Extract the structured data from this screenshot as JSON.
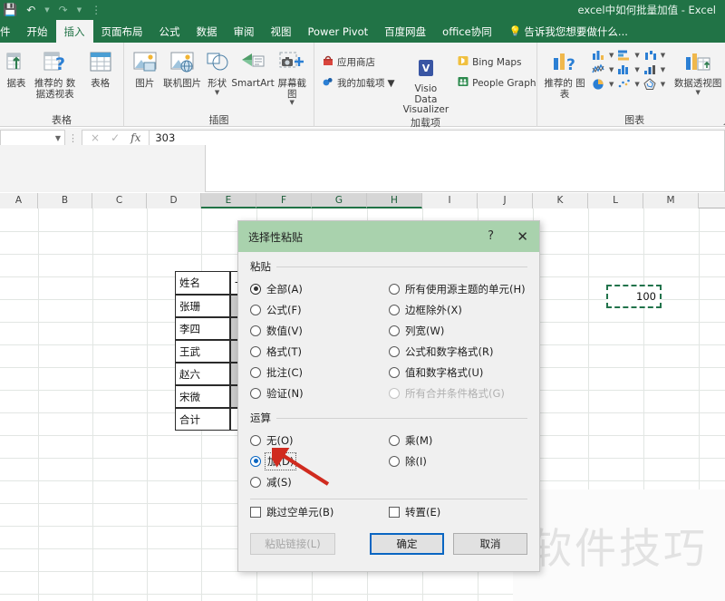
{
  "window": {
    "title": "excel中如何批量加值 - Excel",
    "quick_access": [
      "save-icon",
      "undo-icon",
      "redo-icon",
      "customize-icon"
    ]
  },
  "ribbon": {
    "tabs": [
      {
        "label": "件",
        "active": false
      },
      {
        "label": "开始",
        "active": false
      },
      {
        "label": "插入",
        "active": true
      },
      {
        "label": "页面布局",
        "active": false
      },
      {
        "label": "公式",
        "active": false
      },
      {
        "label": "数据",
        "active": false
      },
      {
        "label": "审阅",
        "active": false
      },
      {
        "label": "视图",
        "active": false
      },
      {
        "label": "Power Pivot",
        "active": false
      },
      {
        "label": "百度网盘",
        "active": false
      },
      {
        "label": "office协同",
        "active": false
      }
    ],
    "tell_me": "告诉我您想要做什么...",
    "groups": [
      {
        "name": "表格",
        "label": "表格",
        "items": [
          "据表",
          "推荐的 数据透视表",
          "表格"
        ]
      },
      {
        "name": "插图",
        "label": "插图",
        "items": [
          "图片",
          "联机图片",
          "形状",
          "SmartArt",
          "屏幕截图"
        ]
      },
      {
        "name": "加载项",
        "label": "加载项",
        "items": [
          "应用商店",
          "我的加载项",
          "Visio Data Visualizer",
          "Bing Maps",
          "People Graph"
        ]
      },
      {
        "name": "图表",
        "label": "图表",
        "items": [
          "推荐的 图表",
          "数据透视图"
        ]
      }
    ]
  },
  "formula_bar": {
    "name_box_value": "",
    "cancel_icon": "×",
    "confirm_icon": "✓",
    "function_icon": "fx",
    "value": "303"
  },
  "sheet": {
    "columns": [
      "A",
      "B",
      "C",
      "D",
      "E",
      "F",
      "G",
      "H",
      "I",
      "J",
      "K",
      "L",
      "M"
    ],
    "selected_columns": [
      "E",
      "F",
      "G",
      "H"
    ],
    "table": {
      "header": [
        "姓名",
        "一季"
      ],
      "rows": [
        "张珊",
        "李四",
        "王武",
        "赵六",
        "宋微",
        "合计"
      ]
    },
    "copied_cell_value": "100"
  },
  "watermark": "软件技巧",
  "dialog": {
    "title": "选择性粘贴",
    "help_icon": "?",
    "close_icon": "✕",
    "paste_section": {
      "label": "粘贴",
      "left_options": [
        {
          "label": "全部(A)",
          "selected": true,
          "disabled": false
        },
        {
          "label": "公式(F)",
          "selected": false,
          "disabled": false
        },
        {
          "label": "数值(V)",
          "selected": false,
          "disabled": false
        },
        {
          "label": "格式(T)",
          "selected": false,
          "disabled": false
        },
        {
          "label": "批注(C)",
          "selected": false,
          "disabled": false
        },
        {
          "label": "验证(N)",
          "selected": false,
          "disabled": false
        }
      ],
      "right_options": [
        {
          "label": "所有使用源主题的单元(H)",
          "selected": false,
          "disabled": false
        },
        {
          "label": "边框除外(X)",
          "selected": false,
          "disabled": false
        },
        {
          "label": "列宽(W)",
          "selected": false,
          "disabled": false
        },
        {
          "label": "公式和数字格式(R)",
          "selected": false,
          "disabled": false
        },
        {
          "label": "值和数字格式(U)",
          "selected": false,
          "disabled": false
        },
        {
          "label": "所有合并条件格式(G)",
          "selected": false,
          "disabled": true
        }
      ]
    },
    "operation_section": {
      "label": "运算",
      "left_options": [
        {
          "label": "无(O)",
          "selected": false,
          "disabled": false
        },
        {
          "label": "加(D)",
          "selected": true,
          "disabled": false,
          "focused": true
        },
        {
          "label": "减(S)",
          "selected": false,
          "disabled": false
        }
      ],
      "right_options": [
        {
          "label": "乘(M)",
          "selected": false,
          "disabled": false
        },
        {
          "label": "除(I)",
          "selected": false,
          "disabled": false
        }
      ]
    },
    "checkboxes": [
      {
        "label": "跳过空单元(B)",
        "checked": false
      },
      {
        "label": "转置(E)",
        "checked": false
      }
    ],
    "buttons": [
      {
        "label": "粘贴链接(L)",
        "disabled": true,
        "primary": false
      },
      {
        "label": "确定",
        "disabled": false,
        "primary": true
      },
      {
        "label": "取消",
        "disabled": false,
        "primary": false
      }
    ]
  },
  "colors": {
    "excel_green": "#217346",
    "dialog_header": "#a9d2ad",
    "accent_blue": "#0a66c2",
    "arrow_red": "#d02b1f"
  }
}
